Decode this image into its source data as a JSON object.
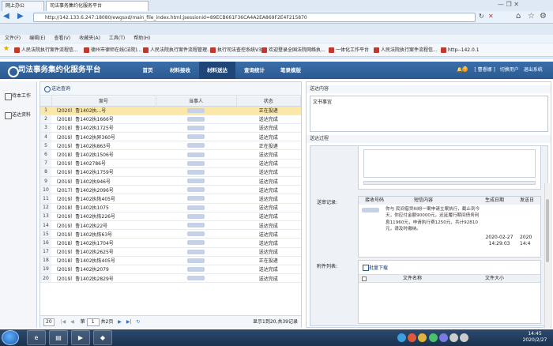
{
  "browser": {
    "tab1": "网上办公",
    "tab2": "司法事务集约化服务平台",
    "url": "http://142.133.6.247:18080/ewgsxd/main_file_index.html;jsessionid=89ECB661F36CA4A2EA869F2E4F215870",
    "menu": [
      "文件(F)",
      "编辑(E)",
      "查看(V)",
      "收藏夹(A)",
      "工具(T)",
      "帮助(H)"
    ],
    "favorites": [
      "人民法院执行案件流程信...",
      "德州市律师在线(法院)...",
      "人民法院执行案件流程管理...",
      "执行司法查控系统V3",
      "欢迎登录全国法院网络执...",
      "一体化工作平台",
      "人民法院执行案件流程信...",
      "http--142.0.1"
    ]
  },
  "app": {
    "title": "司法事务集约化服务平台",
    "nav": [
      "首页",
      "材料接收",
      "材料送达",
      "查询统计",
      "笔录模版"
    ],
    "active_nav": "材料送达",
    "badge": "0",
    "user": "[ 曹睿娜 ]",
    "switch_user": "切换用户",
    "logout": "退出系统"
  },
  "sidebar": {
    "items": [
      "待本工作",
      "送达资料"
    ]
  },
  "table": {
    "query_label": "送达查询",
    "headers": [
      "案号",
      "当事人",
      "状态"
    ],
    "rows": [
      {
        "idx": "1",
        "case": "（2020）鲁1402执...号",
        "status": "正在投递"
      },
      {
        "idx": "2",
        "case": "（2018）鲁1402执1666号",
        "status": "送达完成"
      },
      {
        "idx": "3",
        "case": "（2018）鲁1402执1725号",
        "status": "送达完成"
      },
      {
        "idx": "4",
        "case": "（2019）鲁1402执异360号",
        "status": "送达完成"
      },
      {
        "idx": "5",
        "case": "（2019）鲁1402执863号",
        "status": "正在投递"
      },
      {
        "idx": "6",
        "case": "（2018）鲁1402执1506号",
        "status": "送达完成"
      },
      {
        "idx": "7",
        "case": "（2019）鲁1402786号",
        "status": "送达完成"
      },
      {
        "idx": "8",
        "case": "（2019）鲁1402执1759号",
        "status": "送达完成"
      },
      {
        "idx": "9",
        "case": "（2019）鲁1402执946号",
        "status": "送达完成"
      },
      {
        "idx": "10",
        "case": "（2017）鲁1402执2096号",
        "status": "送达完成"
      },
      {
        "idx": "11",
        "case": "（2019）鲁1402执恢405号",
        "status": "送达完成"
      },
      {
        "idx": "12",
        "case": "（2018）鲁1402执1075",
        "status": "送达完成"
      },
      {
        "idx": "13",
        "case": "（2019）鲁1402执恢226号",
        "status": "送达完成"
      },
      {
        "idx": "14",
        "case": "（2019）鲁1402执22号",
        "status": "送达完成"
      },
      {
        "idx": "15",
        "case": "（2019）鲁1402执恢63号",
        "status": "送达完成"
      },
      {
        "idx": "16",
        "case": "（2018）鲁1402执1704号",
        "status": "送达完成"
      },
      {
        "idx": "17",
        "case": "（2019）鲁1402执2625号",
        "status": "送达完成"
      },
      {
        "idx": "18",
        "case": "（2018）鲁1402执恢405号",
        "status": "正在投递"
      },
      {
        "idx": "19",
        "case": "（2019）鲁1402执2079",
        "status": "送达完成"
      },
      {
        "idx": "20",
        "case": "（2019）鲁1402执2829号",
        "status": "送达完成"
      }
    ],
    "page_size": "20",
    "page_label": "第",
    "page_num": "1",
    "page_total": "共2页",
    "summary": "显示1到20,共39记录"
  },
  "detail": {
    "content_title": "送达内容",
    "content_value": "文书事宜",
    "log_title": "送达过程",
    "sd_label": "送审记录:",
    "sd_headers": [
      "接收号码",
      "短信内容",
      "生成日期",
      "发送日"
    ],
    "sd_text": "你与     民间借贷纠纷一案申请立案执行，截止到今天，你应付金额90000元，迟延履行期间债务利息11960元，申请执行费1250元，共计92810元，请及时缴纳。",
    "sd_date": "2020-02-27",
    "sd_time": "14:29:03",
    "sd_date2": "2020",
    "sd_time2": "14:4",
    "att_label": "附件列表:",
    "upload_label": "批量下载",
    "att_headers": [
      "文件名称",
      "文件大小"
    ]
  },
  "taskbar": {
    "time": "14:45",
    "date": "2020/2/27"
  }
}
